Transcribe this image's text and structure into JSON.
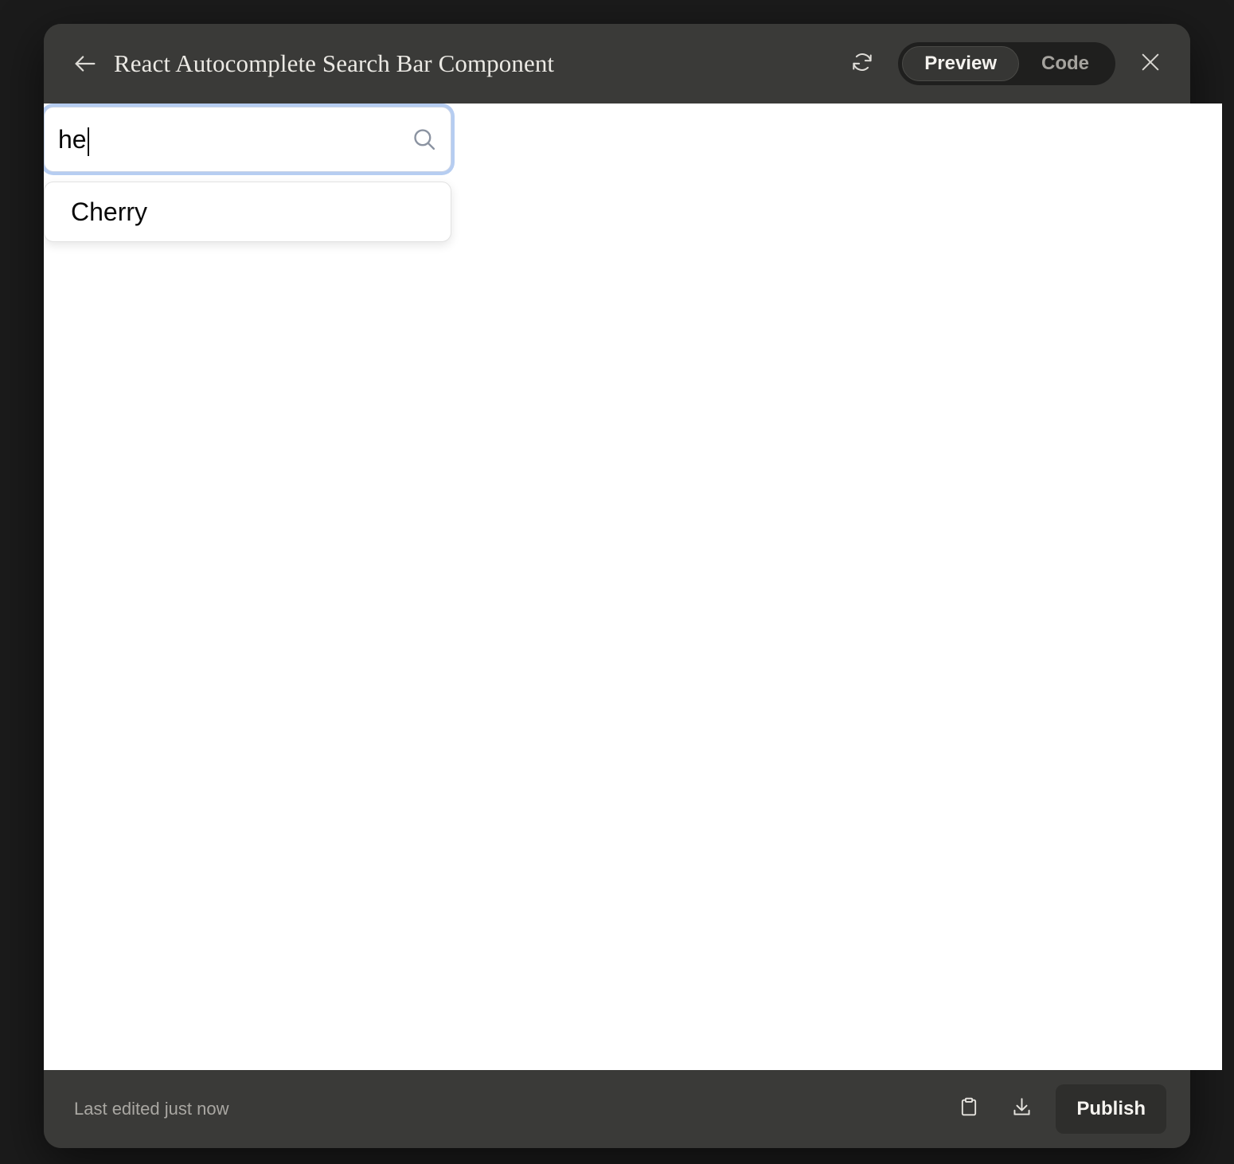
{
  "window": {
    "title": "React Autocomplete Search Bar Component",
    "back_icon": "arrow-left-icon",
    "refresh_icon": "refresh-icon",
    "close_icon": "close-icon",
    "view_toggle": {
      "options": [
        "Preview",
        "Code"
      ],
      "selected": "Preview",
      "preview_label": "Preview",
      "code_label": "Code"
    }
  },
  "preview": {
    "search": {
      "value": "he",
      "placeholder": "Search...",
      "icon": "search-icon"
    },
    "suggestions": [
      {
        "label": "Cherry"
      }
    ]
  },
  "footer": {
    "status": "Last edited just now",
    "copy_icon": "clipboard-icon",
    "download_icon": "download-icon",
    "publish_label": "Publish"
  },
  "colors": {
    "page_background": "#1b1b1b",
    "window_chrome": "#3a3a38",
    "toggle_track": "#1f1f1e",
    "toggle_active": "#363634",
    "canvas": "#ffffff",
    "focus_ring": "#b6cdf1",
    "text_light": "#ebe9e4",
    "text_muted": "#a9a7a2",
    "publish_button": "#2e2e2c"
  }
}
